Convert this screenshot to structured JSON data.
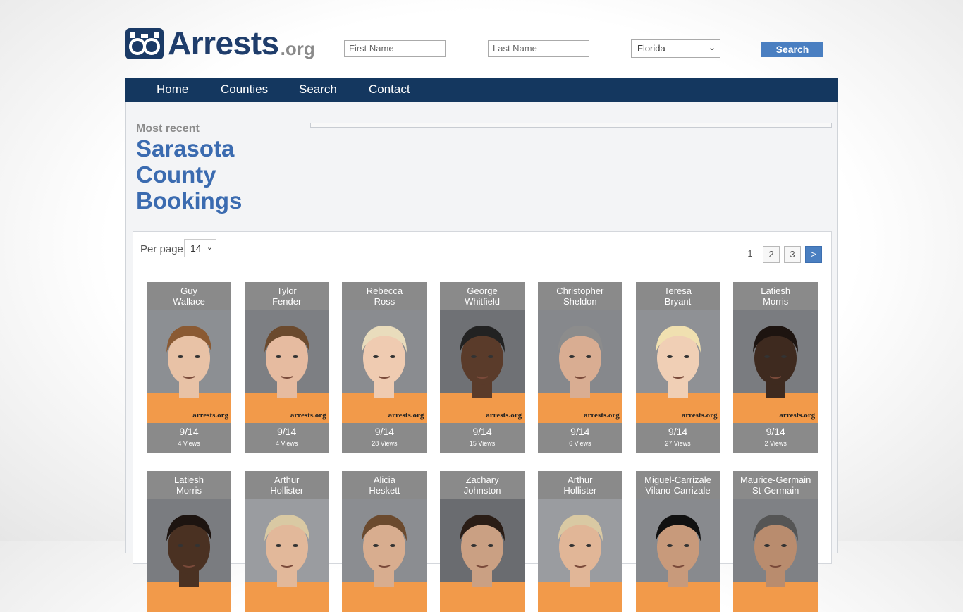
{
  "header": {
    "logo_text": "Arrests",
    "logo_tld": ".org",
    "first_name_placeholder": "First Name",
    "last_name_placeholder": "Last Name",
    "state_selected": "Florida",
    "search_label": "Search"
  },
  "nav": {
    "items": [
      "Home",
      "Counties",
      "Search",
      "Contact"
    ]
  },
  "page": {
    "most_recent": "Most recent",
    "title_line1": "Sarasota",
    "title_line2": "County",
    "title_line3": "Bookings"
  },
  "listing": {
    "per_page_label": "Per page",
    "per_page_value": "14",
    "pages": [
      "1",
      "2",
      "3",
      ">"
    ]
  },
  "watermark": "arrests.org",
  "colors": {
    "nav_bg": "#14375f",
    "accent": "#4a7fc1",
    "title": "#3b6bb0",
    "card_bg": "#8a8a8a"
  },
  "bookings": [
    {
      "first": "Guy",
      "last": "Wallace",
      "date": "9/14",
      "views": "4 Views"
    },
    {
      "first": "Tylor",
      "last": "Fender",
      "date": "9/14",
      "views": "4 Views"
    },
    {
      "first": "Rebecca",
      "last": "Ross",
      "date": "9/14",
      "views": "28 Views"
    },
    {
      "first": "George",
      "last": "Whitfield",
      "date": "9/14",
      "views": "15 Views"
    },
    {
      "first": "Christopher",
      "last": "Sheldon",
      "date": "9/14",
      "views": "6 Views"
    },
    {
      "first": "Teresa",
      "last": "Bryant",
      "date": "9/14",
      "views": "27 Views"
    },
    {
      "first": "Latiesh",
      "last": "Morris",
      "date": "9/14",
      "views": "2 Views"
    },
    {
      "first": "Latiesh",
      "last": "Morris"
    },
    {
      "first": "Arthur",
      "last": "Hollister"
    },
    {
      "first": "Alicia",
      "last": "Heskett"
    },
    {
      "first": "Zachary",
      "last": "Johnston"
    },
    {
      "first": "Arthur",
      "last": "Hollister"
    },
    {
      "first": "Miguel-Carrizale",
      "last": "Vilano-Carrizale"
    },
    {
      "first": "Maurice-Germain",
      "last": "St-Germain"
    }
  ]
}
